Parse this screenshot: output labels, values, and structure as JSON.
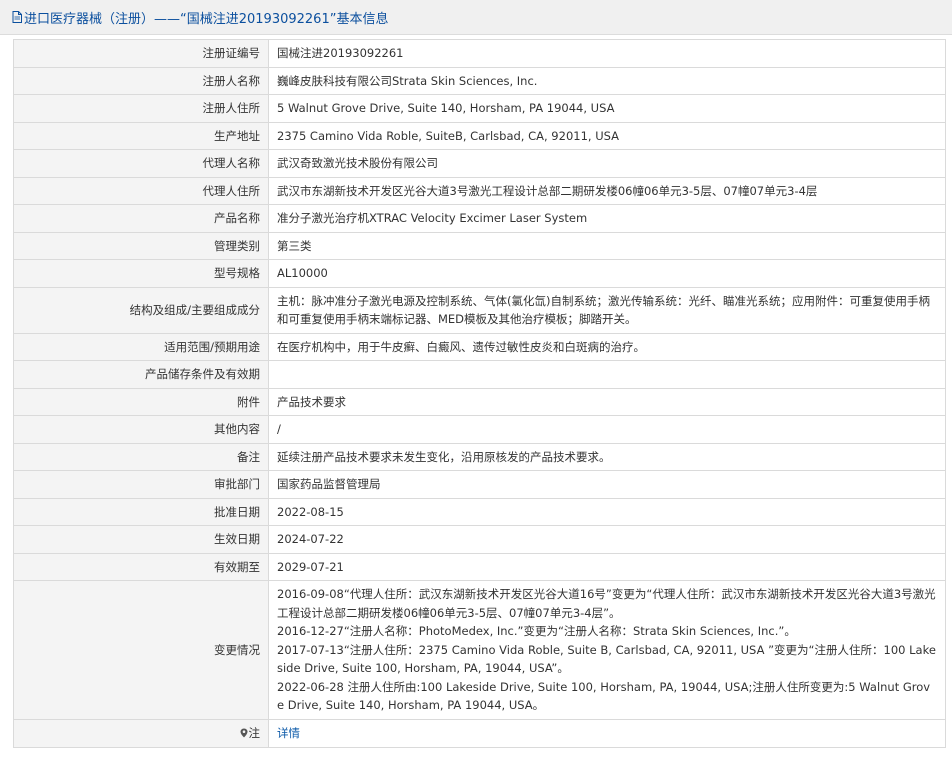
{
  "header": {
    "title": "进口医疗器械（注册）——“国械注进20193092261”基本信息",
    "icon": "document-icon"
  },
  "rows": [
    {
      "label": "注册证编号",
      "value": "国械注进20193092261"
    },
    {
      "label": "注册人名称",
      "value": "巍峰皮肤科技有限公司Strata Skin Sciences, Inc."
    },
    {
      "label": "注册人住所",
      "value": "5 Walnut Grove Drive, Suite 140, Horsham, PA 19044, USA"
    },
    {
      "label": "生产地址",
      "value": "2375 Camino Vida Roble, SuiteB, Carlsbad, CA, 92011, USA"
    },
    {
      "label": "代理人名称",
      "value": "武汉奇致激光技术股份有限公司"
    },
    {
      "label": "代理人住所",
      "value": "武汉市东湖新技术开发区光谷大道3号激光工程设计总部二期研发楼06幢06单元3-5层、07幢07单元3-4层"
    },
    {
      "label": "产品名称",
      "value": "准分子激光治疗机XTRAC Velocity Excimer Laser System"
    },
    {
      "label": "管理类别",
      "value": "第三类"
    },
    {
      "label": "型号规格",
      "value": "AL10000"
    },
    {
      "label": "结构及组成/主要组成成分",
      "value": "主机：脉冲准分子激光电源及控制系统、气体(氯化氙)自制系统；激光传输系统：光纤、瞄准光系统；应用附件：可重复使用手柄和可重复使用手柄末端标记器、MED模板及其他治疗模板；脚踏开关。"
    },
    {
      "label": "适用范围/预期用途",
      "value": "在医疗机构中，用于牛皮癣、白癜风、遗传过敏性皮炎和白斑病的治疗。"
    },
    {
      "label": "产品储存条件及有效期",
      "value": ""
    },
    {
      "label": "附件",
      "value": "产品技术要求"
    },
    {
      "label": "其他内容",
      "value": "/"
    },
    {
      "label": "备注",
      "value": "延续注册产品技术要求未发生变化，沿用原核发的产品技术要求。"
    },
    {
      "label": "审批部门",
      "value": "国家药品监督管理局"
    },
    {
      "label": "批准日期",
      "value": "2022-08-15"
    },
    {
      "label": "生效日期",
      "value": "2024-07-22"
    },
    {
      "label": "有效期至",
      "value": "2029-07-21"
    }
  ],
  "changes": {
    "label": "变更情况",
    "lines": [
      "2016-09-08“代理人住所：武汉东湖新技术开发区光谷大道16号”变更为“代理人住所：武汉市东湖新技术开发区光谷大道3号激光工程设计总部二期研发楼06幢06单元3-5层、07幢07单元3-4层”。",
      "2016-12-27“注册人名称：PhotoMedex, Inc.”变更为“注册人名称：Strata Skin Sciences, Inc.”。",
      "2017-07-13“注册人住所：2375 Camino Vida Roble, Suite B, Carlsbad, CA, 92011, USA ”变更为“注册人住所：100 Lakeside Drive, Suite 100, Horsham, PA, 19044, USA”。",
      "2022-06-28 注册人住所由:100 Lakeside Drive, Suite 100, Horsham, PA, 19044, USA;注册人住所变更为:5 Walnut Grove Drive, Suite 140, Horsham, PA 19044, USA。"
    ]
  },
  "note": {
    "icon": "location-pin-icon",
    "label": "注",
    "link_text": "详情"
  }
}
